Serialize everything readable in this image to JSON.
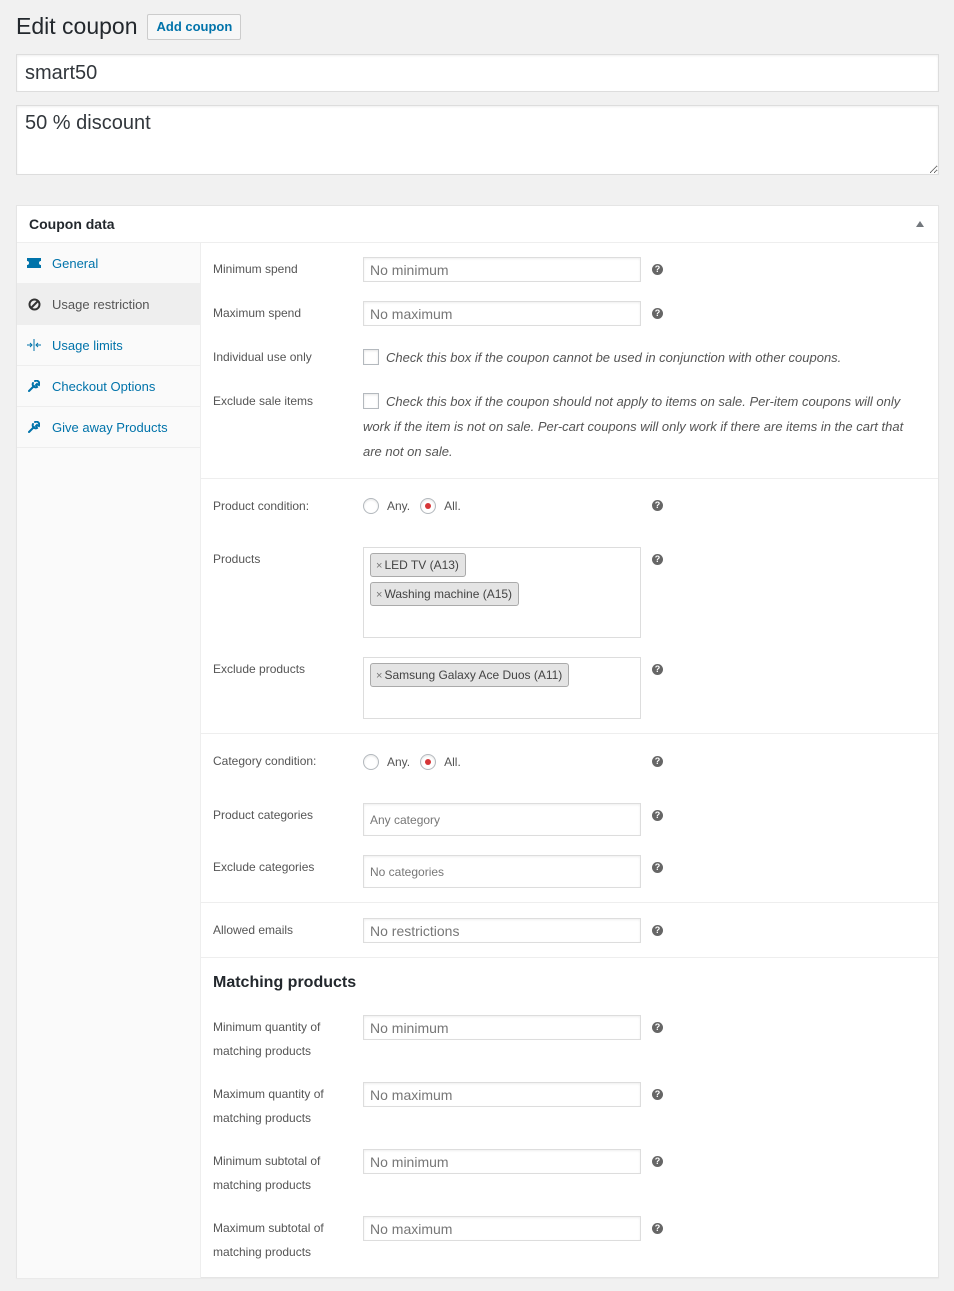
{
  "header": {
    "title": "Edit coupon",
    "add_button": "Add coupon"
  },
  "coupon": {
    "code": "smart50",
    "description": "50 % discount"
  },
  "postbox": {
    "title": "Coupon data",
    "tabs": [
      {
        "label": "General",
        "icon": "ticket-icon",
        "active": false
      },
      {
        "label": "Usage restriction",
        "icon": "block-icon",
        "active": true
      },
      {
        "label": "Usage limits",
        "icon": "arrows-in-icon",
        "active": false
      },
      {
        "label": "Checkout Options",
        "icon": "wrench-icon",
        "active": false
      },
      {
        "label": "Give away Products",
        "icon": "wrench-icon",
        "active": false
      }
    ]
  },
  "usage_restriction": {
    "minimum_spend": {
      "label": "Minimum spend",
      "placeholder": "No minimum",
      "value": ""
    },
    "maximum_spend": {
      "label": "Maximum spend",
      "placeholder": "No maximum",
      "value": ""
    },
    "individual_use": {
      "label": "Individual use only",
      "checked": false,
      "description": "Check this box if the coupon cannot be used in conjunction with other coupons."
    },
    "exclude_sale": {
      "label": "Exclude sale items",
      "checked": false,
      "description": "Check this box if the coupon should not apply to items on sale. Per-item coupons will only work if the item is not on sale. Per-cart coupons will only work if there are items in the cart that are not on sale."
    },
    "product_condition": {
      "label": "Product condition:",
      "options": [
        "Any.",
        "All."
      ],
      "selected": "All."
    },
    "products": {
      "label": "Products",
      "items": [
        "LED TV (A13)",
        "Washing machine (A15)"
      ]
    },
    "exclude_products": {
      "label": "Exclude products",
      "items": [
        "Samsung Galaxy Ace Duos (A11)"
      ]
    },
    "category_condition": {
      "label": "Category condition:",
      "options": [
        "Any.",
        "All."
      ],
      "selected": "All."
    },
    "product_categories": {
      "label": "Product categories",
      "placeholder": "Any category"
    },
    "exclude_categories": {
      "label": "Exclude categories",
      "placeholder": "No categories"
    },
    "allowed_emails": {
      "label": "Allowed emails",
      "placeholder": "No restrictions",
      "value": ""
    }
  },
  "matching_products": {
    "title": "Matching products",
    "min_qty": {
      "label_line1": "Minimum quantity of",
      "label_line2": "matching products",
      "placeholder": "No minimum"
    },
    "max_qty": {
      "label_line1": "Maximum quantity of",
      "label_line2": "matching products",
      "placeholder": "No maximum"
    },
    "min_subtotal": {
      "label_line1": "Minimum subtotal of",
      "label_line2": "matching products",
      "placeholder": "No minimum"
    },
    "max_subtotal": {
      "label_line1": "Maximum subtotal of",
      "label_line2": "matching products",
      "placeholder": "No maximum"
    }
  },
  "help_glyph": "?",
  "chip_remove_glyph": "×",
  "colors": {
    "link": "#0073aa",
    "radio_checked": "#d63638",
    "background": "#f1f1f1"
  }
}
